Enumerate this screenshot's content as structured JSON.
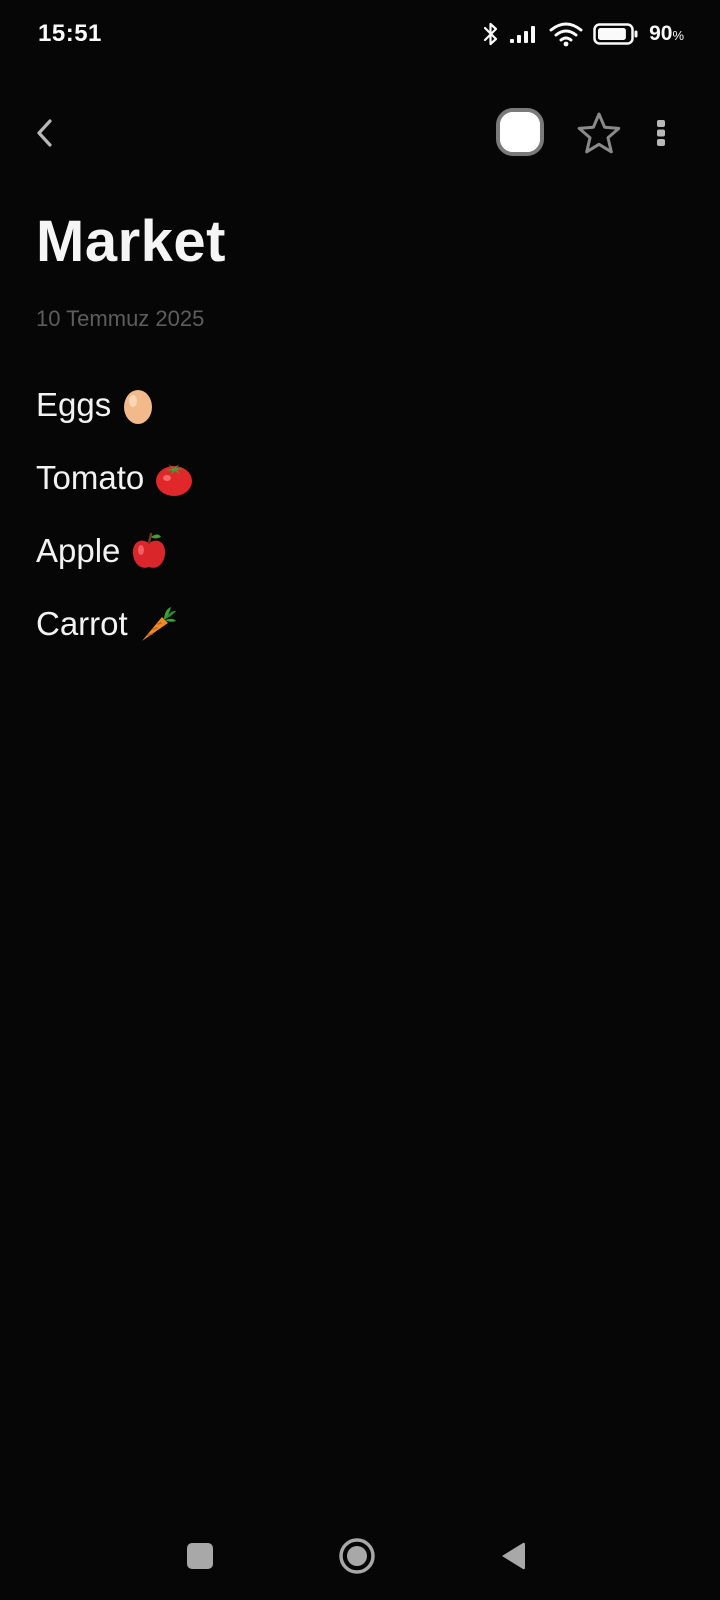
{
  "status_bar": {
    "time": "15:51",
    "battery_percent": "90",
    "battery_unit": "%",
    "battery_level": 0.9,
    "icons": [
      "bluetooth-icon",
      "signal-icon",
      "wifi-icon",
      "battery-icon"
    ]
  },
  "toolbar": {
    "back_icon": "chevron-left-icon",
    "note_color": "#ffffff",
    "favorite_icon": "star-outline-icon",
    "more_icon": "more-vertical-icon"
  },
  "note": {
    "title": "Market",
    "date": "10 Temmuz 2025",
    "lines": [
      {
        "text": "Eggs",
        "emoji": "egg"
      },
      {
        "text": "Tomato",
        "emoji": "tomato"
      },
      {
        "text": "Apple",
        "emoji": "apple"
      },
      {
        "text": "Carrot",
        "emoji": "carrot"
      }
    ]
  },
  "nav_bar": {
    "buttons": [
      "recents-button",
      "home-button",
      "back-button"
    ]
  },
  "colors": {
    "background": "#060606",
    "text": "#f2f2f2",
    "date_text": "#5d5d5d",
    "icon_gray": "#8a8a8a"
  }
}
